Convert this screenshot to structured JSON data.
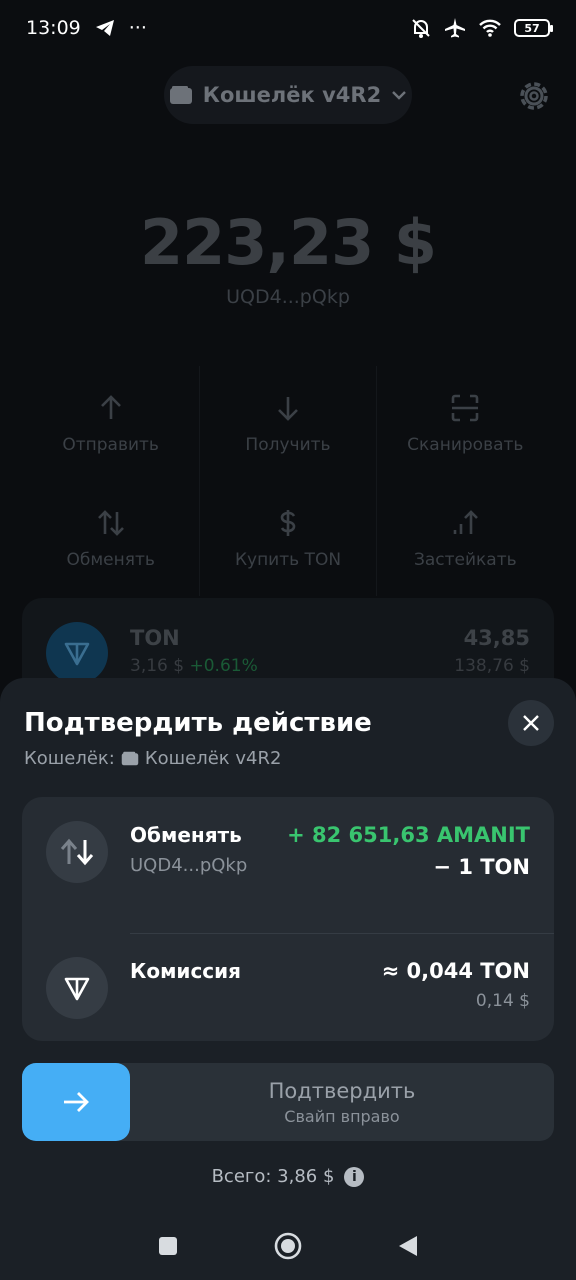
{
  "status": {
    "time": "13:09",
    "more": "···",
    "battery": "57"
  },
  "wallet": {
    "name": "Кошелёк v4R2"
  },
  "balance": {
    "amount": "223,23 $",
    "address": "UQD4...pQkp"
  },
  "actions": [
    {
      "label": "Отправить",
      "icon": "arrow-up-icon"
    },
    {
      "label": "Получить",
      "icon": "arrow-down-icon"
    },
    {
      "label": "Сканировать",
      "icon": "scan-icon"
    },
    {
      "label": "Обменять",
      "icon": "swap-icon"
    },
    {
      "label": "Купить TON",
      "icon": "dollar-icon"
    },
    {
      "label": "Застейкать",
      "icon": "stake-icon"
    }
  ],
  "token": {
    "name": "TON",
    "price": "3,16 $",
    "change": "+0.61%",
    "amount": "43,85",
    "usd": "138,76 $"
  },
  "sheet": {
    "title": "Подтвердить действие",
    "wallet_label": "Кошелёк:",
    "wallet_name": "Кошелёк v4R2",
    "swap": {
      "title": "Обменять",
      "address": "UQD4...pQkp",
      "receive": "+ 82 651,63 AMANIT",
      "send": "− 1 TON"
    },
    "fee": {
      "title": "Комиссия",
      "amount": "≈ 0,044 TON",
      "usd": "0,14 $"
    },
    "confirm": {
      "label": "Подтвердить",
      "hint": "Свайп вправо"
    },
    "total": "Всего: 3,86 $"
  },
  "colors": {
    "accent": "#45aef5",
    "positive": "#39c56f",
    "sheet_bg": "#1b2026"
  }
}
